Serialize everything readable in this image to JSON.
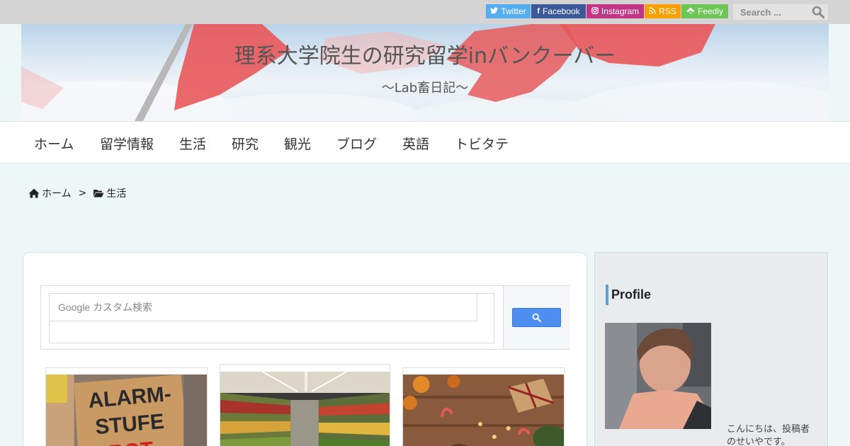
{
  "topbar": {
    "social": [
      {
        "label": "Twitter",
        "icon": "twitter-icon",
        "color": "#55acee"
      },
      {
        "label": "Facebook",
        "icon": "facebook-icon",
        "color": "#3b5998"
      },
      {
        "label": "Instagram",
        "icon": "instagram-icon",
        "color": "#c13584"
      },
      {
        "label": "RSS",
        "icon": "rss-icon",
        "color": "#f7a000"
      },
      {
        "label": "Feedly",
        "icon": "feedly-icon",
        "color": "#6cc655"
      }
    ],
    "search_placeholder": "Search ..."
  },
  "header": {
    "title": "理系大学院生の研究留学inバンクーバー",
    "tagline": "～Lab畜日記～"
  },
  "nav": {
    "items": [
      {
        "label": "ホーム"
      },
      {
        "label": "留学情報"
      },
      {
        "label": "生活"
      },
      {
        "label": "研究"
      },
      {
        "label": "観光"
      },
      {
        "label": "ブログ"
      },
      {
        "label": "英語"
      },
      {
        "label": "トビタテ"
      }
    ]
  },
  "breadcrumb": {
    "home": "ホーム",
    "separator": ">",
    "current": "生活"
  },
  "main": {
    "search": {
      "placeholder": "Google カスタム検索",
      "button_icon": "search-icon"
    },
    "cards": [
      {
        "thumb_text_1": "ALARM-",
        "thumb_text_2": "STUFE",
        "thumb_text_3": "ROT"
      },
      {},
      {}
    ]
  },
  "sidebar": {
    "profile_title": "Profile",
    "profile_text_1": "こんにちは、投稿者",
    "profile_text_2": "のせいやです。"
  },
  "colors": {
    "topbar_bg": "#d4d4d4",
    "page_bg": "#eef7f7",
    "accent": "#5aa0d6",
    "google_button": "#4d8ff0"
  }
}
